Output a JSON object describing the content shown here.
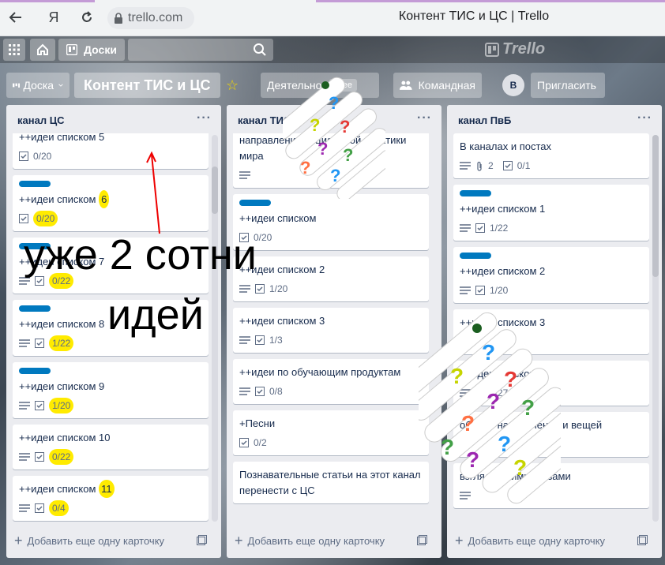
{
  "browser": {
    "back_icon": "arrow-left-icon",
    "yandex_label": "Я",
    "reload_icon": "reload-icon",
    "address": "trello.com",
    "tab_title": "Контент ТИС и ЦС | Trello"
  },
  "header": {
    "boards_label": "Доски",
    "logo": "Trello"
  },
  "board": {
    "switcher_label": "Доска",
    "title": "Контент ТИС и ЦС",
    "activity_label": "Деятельно",
    "free_label": "Free",
    "team_label": "Командная",
    "avatar_letter": "В",
    "invite_label": "Пригласить"
  },
  "lists": [
    {
      "title": "канал ЦС",
      "add_label": "Добавить еще одну карточку",
      "cards": [
        {
          "title": "++идеи списком 5",
          "label": false,
          "checklist": "0/20",
          "desc": false,
          "hl": false
        },
        {
          "title": "++идеи списком ",
          "title_hl": "6",
          "label": true,
          "checklist": "0/20",
          "desc": false,
          "hl": true
        },
        {
          "title": "++идеи списком 7",
          "label": true,
          "checklist": "0/22",
          "desc": true,
          "hl": true
        },
        {
          "title": "++идеи списком 8",
          "label": true,
          "checklist": "1/22",
          "desc": true,
          "hl": true
        },
        {
          "title": "++идеи списком 9",
          "label": true,
          "checklist": "1/20",
          "desc": true,
          "hl": true
        },
        {
          "title": "++идеи списком 10",
          "label": false,
          "checklist": "0/22",
          "desc": true,
          "hl": true
        },
        {
          "title": "++идеи списком ",
          "title_hl": "11",
          "label": false,
          "checklist": "0/4",
          "desc": true,
          "hl": true
        }
      ]
    },
    {
      "title": "канал ТИС",
      "add_label": "Добавить еще одну карточку",
      "cards": [
        {
          "title": "направления социальной практики мира",
          "label": false,
          "checklist": "",
          "desc": true
        },
        {
          "title": "++идеи списком",
          "label": true,
          "checklist": "0/20",
          "desc": false
        },
        {
          "title": "++идеи списком 2",
          "label": false,
          "checklist": "1/20",
          "desc": true
        },
        {
          "title": "++идеи списком 3",
          "label": false,
          "checklist": "1/3",
          "desc": true
        },
        {
          "title": "++идеи по обучающим продуктам",
          "label": false,
          "checklist": "0/8",
          "desc": true
        },
        {
          "title": "+Песни",
          "label": false,
          "checklist": "0/2",
          "desc": false
        },
        {
          "title": "Познавательные статьи на этот канал перенести с ЦС",
          "label": false,
          "checklist": "",
          "desc": false
        }
      ]
    },
    {
      "title": "канал ПвБ",
      "add_label": "Добавить еще одну карточку",
      "cards": [
        {
          "title": "В каналах и постах",
          "label": false,
          "attachments": "2",
          "checklist": "0/1",
          "desc": true
        },
        {
          "title": "++идеи списком 1",
          "label": true,
          "checklist": "1/22",
          "desc": true
        },
        {
          "title": "++идеи списком 2",
          "label": true,
          "checklist": "1/20",
          "desc": true
        },
        {
          "title": "++идеи списком 3",
          "label": false,
          "checklist": "",
          "desc": false
        },
        {
          "title": "++идеи списком 4",
          "label": false,
          "checklist": "1/27",
          "desc": true
        },
        {
          "title": "обзоры направлений и вещей",
          "label": false,
          "checklist": "",
          "desc": false
        },
        {
          "title": "взгляд чужими глазами",
          "label": false,
          "checklist": "",
          "desc": true
        }
      ]
    }
  ],
  "annotation": {
    "line1": "уже 2 сотни",
    "line2": "идей"
  }
}
